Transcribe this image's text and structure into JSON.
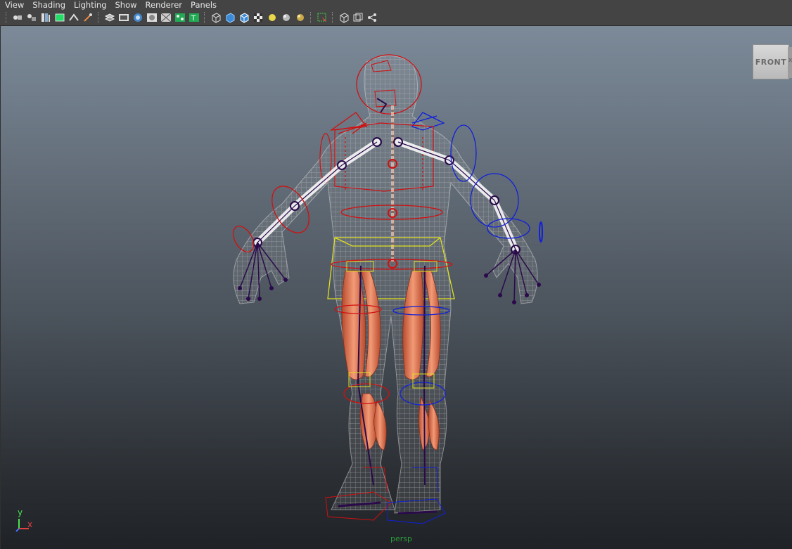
{
  "menu": {
    "view": "View",
    "shading": "Shading",
    "lighting": "Lighting",
    "show": "Show",
    "renderer": "Renderer",
    "panels": "Panels"
  },
  "toolbar": {
    "icons": [
      "select-camera-icon",
      "camera-attributes-icon",
      "bookmarks-icon",
      "image-plane-icon",
      "2d-pan-zoom-icon",
      "grease-pencil-icon",
      "grid-icon",
      "film-gate-icon",
      "resolution-gate-icon",
      "gate-mask-icon",
      "field-chart-icon",
      "safe-action-icon",
      "safe-title-icon",
      "wireframe-icon",
      "smooth-shade-icon",
      "wireframe-on-shaded-icon",
      "textured-icon",
      "use-all-lights-icon",
      "shadows-icon",
      "ambient-occlusion-icon",
      "isolate-select-icon",
      "xray-icon",
      "xray-active-components-icon",
      "xray-joints-icon"
    ]
  },
  "viewport": {
    "camera": "persp",
    "viewcube": {
      "face": "FRONT",
      "side": "x"
    },
    "axis": {
      "y": "y",
      "x": "x"
    }
  },
  "colors": {
    "menu_bg": "#444444",
    "viewport_top": "#7c8a99",
    "viewport_bottom": "#1f2226",
    "joint_color": "#2a0a4a",
    "left_ctrl": "#d01010",
    "right_ctrl": "#1020d8",
    "center_ctrl": "#e0e020",
    "muscle": "#e07a5a",
    "camera_label": "#2c9a3a"
  }
}
